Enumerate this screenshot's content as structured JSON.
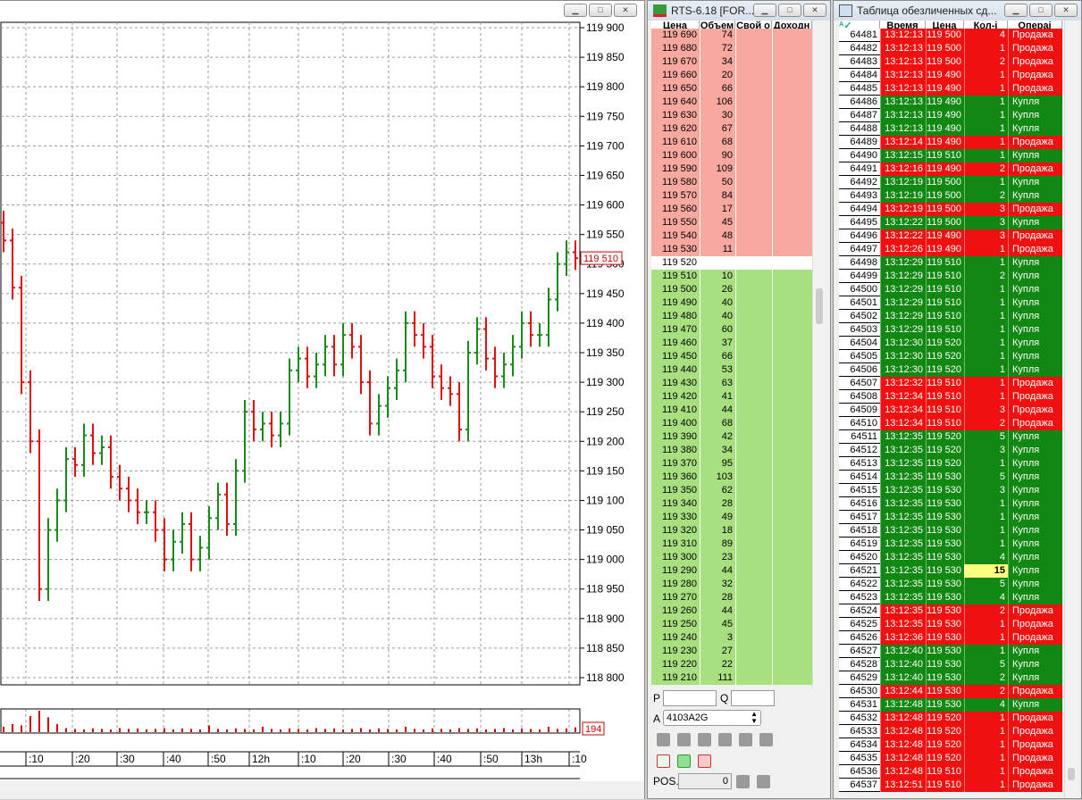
{
  "chart_window": {
    "price_tag": "119 510",
    "volume_tag": "194",
    "y_ticks": [
      "119 900",
      "119 850",
      "119 800",
      "119 750",
      "119 700",
      "119 650",
      "119 600",
      "119 550",
      "119 500",
      "119 450",
      "119 400",
      "119 350",
      "119 300",
      "119 250",
      "119 200",
      "119 150",
      "119 100",
      "119 050",
      "119 000",
      "118 950",
      "118 900",
      "118 850",
      "118 800"
    ],
    "x_ticks": [
      ":10",
      ":20",
      ":30",
      ":40",
      ":50",
      "12h",
      ":10",
      ":20",
      ":30",
      ":40",
      ":50",
      "13h",
      ":10"
    ]
  },
  "chart_data": {
    "type": "ohlc",
    "ylim": [
      118800,
      119900
    ],
    "up_color": "#1a8a1a",
    "down_color": "#e01010",
    "closes": [
      119540,
      119460,
      119300,
      119200,
      118950,
      119050,
      119100,
      119170,
      119160,
      119210,
      119180,
      119190,
      119140,
      119120,
      119100,
      119080,
      119080,
      119050,
      119000,
      119030,
      119060,
      119000,
      119020,
      119070,
      119110,
      119060,
      119150,
      119250,
      119220,
      119230,
      119210,
      119230,
      119320,
      119340,
      119310,
      119330,
      119360,
      119330,
      119380,
      119360,
      119300,
      119230,
      119260,
      119290,
      119320,
      119400,
      119380,
      119360,
      119310,
      119290,
      119280,
      119220,
      119350,
      119390,
      119340,
      119310,
      119330,
      119360,
      119400,
      119380,
      119380,
      119440,
      119500,
      119520,
      119510
    ],
    "volumes": [
      20,
      30,
      25,
      60,
      80,
      55,
      30,
      15,
      12,
      10,
      14,
      12,
      10,
      15,
      12,
      14,
      10,
      12,
      15,
      10,
      14,
      12,
      10,
      25,
      12,
      10,
      14,
      12,
      10,
      20,
      12,
      10,
      14,
      12,
      10,
      15,
      12,
      14,
      10,
      12,
      15,
      10,
      14,
      12,
      10,
      20,
      12,
      10,
      14,
      12,
      10,
      15,
      12,
      14,
      10,
      12,
      15,
      10,
      14,
      12,
      10,
      20,
      12,
      14,
      18
    ]
  },
  "orderbook": {
    "title": "RTS-6.18 [FOR...",
    "headers": [
      "Цена",
      "Объем",
      "Свой о",
      "Доходн"
    ],
    "asks": [
      [
        "119 690",
        "74"
      ],
      [
        "119 680",
        "72"
      ],
      [
        "119 670",
        "34"
      ],
      [
        "119 660",
        "20"
      ],
      [
        "119 650",
        "66"
      ],
      [
        "119 640",
        "106"
      ],
      [
        "119 630",
        "30"
      ],
      [
        "119 620",
        "67"
      ],
      [
        "119 610",
        "68"
      ],
      [
        "119 600",
        "90"
      ],
      [
        "119 590",
        "109"
      ],
      [
        "119 580",
        "50"
      ],
      [
        "119 570",
        "84"
      ],
      [
        "119 560",
        "17"
      ],
      [
        "119 550",
        "45"
      ],
      [
        "119 540",
        "48"
      ],
      [
        "119 530",
        "11"
      ]
    ],
    "spread": [
      "119 520",
      ""
    ],
    "bids": [
      [
        "119 510",
        "10"
      ],
      [
        "119 500",
        "26"
      ],
      [
        "119 490",
        "40"
      ],
      [
        "119 480",
        "40"
      ],
      [
        "119 470",
        "60"
      ],
      [
        "119 460",
        "37"
      ],
      [
        "119 450",
        "66"
      ],
      [
        "119 440",
        "53"
      ],
      [
        "119 430",
        "63"
      ],
      [
        "119 420",
        "41"
      ],
      [
        "119 410",
        "44"
      ],
      [
        "119 400",
        "68"
      ],
      [
        "119 390",
        "42"
      ],
      [
        "119 380",
        "34"
      ],
      [
        "119 370",
        "95"
      ],
      [
        "119 360",
        "103"
      ],
      [
        "119 350",
        "62"
      ],
      [
        "119 340",
        "28"
      ],
      [
        "119 330",
        "49"
      ],
      [
        "119 320",
        "18"
      ],
      [
        "119 310",
        "89"
      ],
      [
        "119 300",
        "23"
      ],
      [
        "119 290",
        "44"
      ],
      [
        "119 280",
        "32"
      ],
      [
        "119 270",
        "28"
      ],
      [
        "119 260",
        "44"
      ],
      [
        "119 250",
        "45"
      ],
      [
        "119 240",
        "3"
      ],
      [
        "119 230",
        "27"
      ],
      [
        "119 220",
        "22"
      ],
      [
        "119 210",
        "111"
      ]
    ],
    "p_label": "P",
    "q_label": "Q",
    "a_label": "A",
    "account": "4103A2G",
    "pos_label": "POS.",
    "pos_value": "0"
  },
  "trades": {
    "title": "Таблица обезличенных сд...",
    "headers": [
      "",
      "Время",
      "Цена",
      "Кол-і",
      "Операі"
    ],
    "sell": "Продажа",
    "buy": "Купля",
    "rows": [
      [
        "64481",
        "13:12:13",
        "119 500",
        "4",
        "S"
      ],
      [
        "64482",
        "13:12:13",
        "119 500",
        "1",
        "S"
      ],
      [
        "64483",
        "13:12:13",
        "119 500",
        "2",
        "S"
      ],
      [
        "64484",
        "13:12:13",
        "119 490",
        "1",
        "S"
      ],
      [
        "64485",
        "13:12:13",
        "119 490",
        "1",
        "S"
      ],
      [
        "64486",
        "13:12:13",
        "119 490",
        "1",
        "B"
      ],
      [
        "64487",
        "13:12:13",
        "119 490",
        "1",
        "B"
      ],
      [
        "64488",
        "13:12:13",
        "119 490",
        "1",
        "B"
      ],
      [
        "64489",
        "13:12:14",
        "119 490",
        "1",
        "S"
      ],
      [
        "64490",
        "13:12:15",
        "119 510",
        "1",
        "B"
      ],
      [
        "64491",
        "13:12:16",
        "119 490",
        "2",
        "S"
      ],
      [
        "64492",
        "13:12:19",
        "119 500",
        "1",
        "B"
      ],
      [
        "64493",
        "13:12:19",
        "119 500",
        "2",
        "B"
      ],
      [
        "64494",
        "13:12:19",
        "119 500",
        "3",
        "S"
      ],
      [
        "64495",
        "13:12:22",
        "119 500",
        "3",
        "B"
      ],
      [
        "64496",
        "13:12:22",
        "119 490",
        "3",
        "S"
      ],
      [
        "64497",
        "13:12:26",
        "119 490",
        "1",
        "S"
      ],
      [
        "64498",
        "13:12:29",
        "119 510",
        "1",
        "B"
      ],
      [
        "64499",
        "13:12:29",
        "119 510",
        "2",
        "B"
      ],
      [
        "64500",
        "13:12:29",
        "119 510",
        "1",
        "B"
      ],
      [
        "64501",
        "13:12:29",
        "119 510",
        "1",
        "B"
      ],
      [
        "64502",
        "13:12:29",
        "119 510",
        "1",
        "B"
      ],
      [
        "64503",
        "13:12:29",
        "119 510",
        "1",
        "B"
      ],
      [
        "64504",
        "13:12:30",
        "119 520",
        "1",
        "B"
      ],
      [
        "64505",
        "13:12:30",
        "119 520",
        "1",
        "B"
      ],
      [
        "64506",
        "13:12:30",
        "119 520",
        "1",
        "B"
      ],
      [
        "64507",
        "13:12:32",
        "119 510",
        "1",
        "S"
      ],
      [
        "64508",
        "13:12:34",
        "119 510",
        "1",
        "S"
      ],
      [
        "64509",
        "13:12:34",
        "119 510",
        "3",
        "S"
      ],
      [
        "64510",
        "13:12:34",
        "119 510",
        "2",
        "S"
      ],
      [
        "64511",
        "13:12:35",
        "119 520",
        "5",
        "B"
      ],
      [
        "64512",
        "13:12:35",
        "119 520",
        "3",
        "B"
      ],
      [
        "64513",
        "13:12:35",
        "119 520",
        "1",
        "B"
      ],
      [
        "64514",
        "13:12:35",
        "119 530",
        "5",
        "B"
      ],
      [
        "64515",
        "13:12:35",
        "119 530",
        "3",
        "B"
      ],
      [
        "64516",
        "13:12:35",
        "119 530",
        "1",
        "B"
      ],
      [
        "64517",
        "13:12:35",
        "119 530",
        "1",
        "B"
      ],
      [
        "64518",
        "13:12:35",
        "119 530",
        "1",
        "B"
      ],
      [
        "64519",
        "13:12:35",
        "119 530",
        "1",
        "B"
      ],
      [
        "64520",
        "13:12:35",
        "119 530",
        "4",
        "B"
      ],
      [
        "64521",
        "13:12:35",
        "119 530",
        "15",
        "B"
      ],
      [
        "64522",
        "13:12:35",
        "119 530",
        "5",
        "B"
      ],
      [
        "64523",
        "13:12:35",
        "119 530",
        "4",
        "B"
      ],
      [
        "64524",
        "13:12:35",
        "119 530",
        "2",
        "S"
      ],
      [
        "64525",
        "13:12:35",
        "119 530",
        "1",
        "S"
      ],
      [
        "64526",
        "13:12:36",
        "119 530",
        "1",
        "S"
      ],
      [
        "64527",
        "13:12:40",
        "119 530",
        "1",
        "B"
      ],
      [
        "64528",
        "13:12:40",
        "119 530",
        "5",
        "B"
      ],
      [
        "64529",
        "13:12:40",
        "119 530",
        "2",
        "B"
      ],
      [
        "64530",
        "13:12:44",
        "119 530",
        "2",
        "S"
      ],
      [
        "64531",
        "13:12:48",
        "119 530",
        "4",
        "B"
      ],
      [
        "64532",
        "13:12:48",
        "119 520",
        "1",
        "S"
      ],
      [
        "64533",
        "13:12:48",
        "119 520",
        "1",
        "S"
      ],
      [
        "64534",
        "13:12:48",
        "119 520",
        "1",
        "S"
      ],
      [
        "64535",
        "13:12:48",
        "119 520",
        "1",
        "S"
      ],
      [
        "64536",
        "13:12:48",
        "119 510",
        "1",
        "S"
      ],
      [
        "64537",
        "13:12:51",
        "119 510",
        "1",
        "S"
      ]
    ],
    "highlight_qty": "15"
  }
}
